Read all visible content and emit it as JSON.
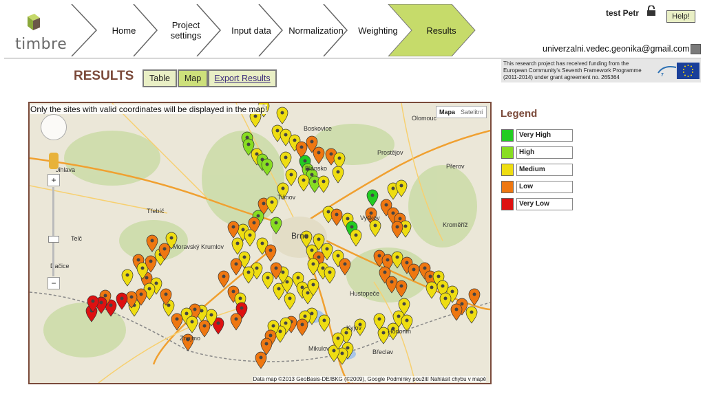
{
  "app": {
    "logo_text": "timbre"
  },
  "nav": [
    {
      "label": "Home"
    },
    {
      "label": "Project settings"
    },
    {
      "label": "Input data"
    },
    {
      "label": "Normalization"
    },
    {
      "label": "Weighting"
    },
    {
      "label": "Results",
      "active": true
    }
  ],
  "user": {
    "name": "test Petr",
    "email": "univerzalni.vedec.geonika@gmail.com",
    "help_label": "Help!"
  },
  "funding": {
    "text": "This research project has received funding from the European Community's Seventh Framework Programme (2011-2014) under grant agreement no. 265364"
  },
  "results": {
    "title": "RESULTS",
    "table_label": "Table",
    "map_label": "Map",
    "export_label": "Export Results"
  },
  "map": {
    "notice": "Only the sites with valid coordinates will be displayed in the map!",
    "type_map": "Mapa",
    "type_sat": "Satelitní",
    "footer": "Data map ©2013 GeoBasis-DE/BKG (©2009), Google   Podmínky použití   Nahlásit chybu v mapě",
    "places": [
      "Jihlava",
      "Třebíč",
      "Brno",
      "Znojmo",
      "Břeclav",
      "Blansko",
      "Vyškov",
      "Hodonín",
      "Kroměříž",
      "Olomouc",
      "Prostějov",
      "Přerov",
      "Mikulov",
      "Telč",
      "Dačice",
      "Moravský Krumlov",
      "Boskovice",
      "Tišnov",
      "Hustopeče",
      "Kyjov"
    ]
  },
  "legend": {
    "title": "Legend",
    "items": [
      {
        "label": "Very High",
        "color": "#22cc22"
      },
      {
        "label": "High",
        "color": "#88dd22"
      },
      {
        "label": "Medium",
        "color": "#eedd11"
      },
      {
        "label": "Low",
        "color": "#ee7711"
      },
      {
        "label": "Very Low",
        "color": "#dd1111"
      }
    ]
  },
  "colors": {
    "accent": "#c6db6a",
    "brand_brown": "#7b4a3a"
  }
}
